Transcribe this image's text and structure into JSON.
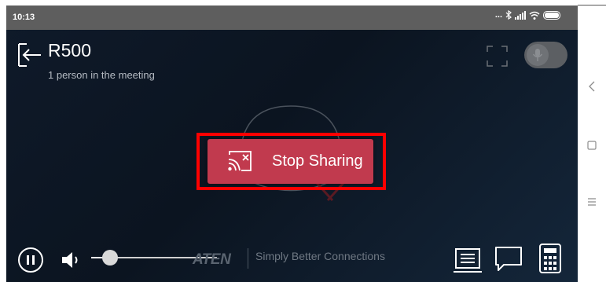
{
  "status_bar": {
    "time": "10:13",
    "indicators": "... ",
    "icons": [
      "bluetooth-icon",
      "signal-icon",
      "wifi-icon",
      "battery-icon"
    ]
  },
  "header": {
    "room_name": "R500",
    "participants": "1 person in the meeting"
  },
  "main": {
    "stop_sharing_label": "Stop Sharing",
    "button_color": "#c13a4e",
    "highlight_color": "#ff0000"
  },
  "footer": {
    "volume_level": 0.15,
    "brand": "ATEN",
    "tagline": "Simply Better Connections"
  },
  "nav_bar": {
    "icons": [
      "back-icon",
      "home-icon",
      "menu-icon"
    ]
  }
}
